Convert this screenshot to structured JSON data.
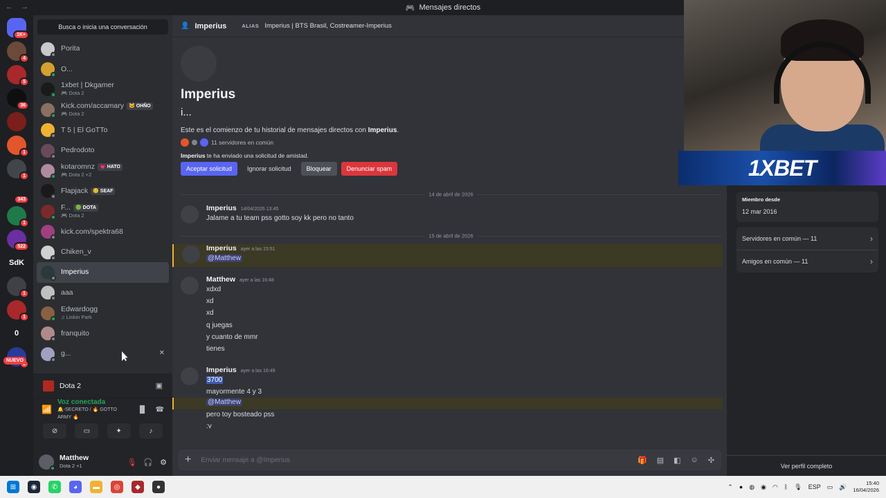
{
  "window": {
    "title": "Mensajes directos",
    "nav_arrows": "← →"
  },
  "guilds": {
    "items": [
      {
        "label": "",
        "badge": "1K+",
        "color": "#5865f2"
      },
      {
        "label": "",
        "badge": "4",
        "color": "#6b4a3a"
      },
      {
        "label": "",
        "badge": "5",
        "color": "#a8282b"
      },
      {
        "label": "",
        "badge": "36",
        "color": "#0f0f10"
      },
      {
        "label": "",
        "badge": "",
        "color": "#7a1f1a"
      },
      {
        "label": "",
        "badge": "1",
        "color": "#e2562d"
      },
      {
        "label": "",
        "badge": "1",
        "color": "#42454a"
      },
      {
        "label": "",
        "badge": "343",
        "color": "#1e1f22"
      },
      {
        "label": "",
        "badge": "1",
        "color": "#1f7a4a"
      },
      {
        "label": "",
        "badge": "522",
        "color": "#6a2fa0"
      },
      {
        "label": "SdK",
        "badge": "",
        "color": "#1e1f22"
      },
      {
        "label": "",
        "badge": "1",
        "color": "#3f4147"
      },
      {
        "label": "",
        "badge": "1",
        "color": "#a8282b"
      },
      {
        "label": "0",
        "badge": "",
        "color": "#1e1f22"
      },
      {
        "label": "",
        "badge": "2",
        "color": "#2a3a9a"
      }
    ],
    "new_label": "NUEVO"
  },
  "dm": {
    "search_label": "Busca o inicia una conversación",
    "items": [
      {
        "name": "Porita",
        "sub": "",
        "tag": "",
        "online": false,
        "color": "#c9c9c9"
      },
      {
        "name": "O...",
        "sub": "",
        "tag": "",
        "online": true,
        "color": "#d4a030"
      },
      {
        "name": "1xbet | Dkgamer",
        "sub": "🎮 Dota 2",
        "tag": "",
        "online": true,
        "color": "#1a1a1a"
      },
      {
        "name": "Kick.com/accamary",
        "sub": "🎮 Dota 2",
        "tag": "🐱 OHÑO",
        "online": true,
        "color": "#8a7060"
      },
      {
        "name": "T 5 | El GoTTo",
        "sub": "",
        "tag": "",
        "online": false,
        "color": "#f0b232"
      },
      {
        "name": "Pedrodoto",
        "sub": "",
        "tag": "",
        "online": false,
        "color": "#6a4a5a"
      },
      {
        "name": "kotaromnz",
        "sub": "🎮 Dota 2 +2",
        "tag": "💗 HATO",
        "online": true,
        "color": "#b08aa0"
      },
      {
        "name": "Flapjack",
        "sub": "",
        "tag": "😊 SEAF",
        "online": false,
        "color": "#1a1a1a"
      },
      {
        "name": "F...",
        "sub": "🎮 Dota 2",
        "tag": "🟢 DOTA",
        "online": true,
        "color": "#7a2a2a"
      },
      {
        "name": "kick.com/spektra68",
        "sub": "",
        "tag": "",
        "online": false,
        "color": "#a04080"
      },
      {
        "name": "Chiken_v",
        "sub": "",
        "tag": "",
        "online": false,
        "color": "#d0d0d0"
      },
      {
        "name": "Imperius",
        "sub": "",
        "tag": "",
        "online": false,
        "color": "#2a3a3a"
      },
      {
        "name": "aaa",
        "sub": "",
        "tag": "",
        "online": false,
        "color": "#c0c0c0"
      },
      {
        "name": "Edwardogg",
        "sub": "♫ Linkin Park",
        "tag": "",
        "online": true,
        "color": "#8a6040"
      },
      {
        "name": "franquito",
        "sub": "",
        "tag": "",
        "online": false,
        "color": "#b08a8a"
      },
      {
        "name": "g...",
        "sub": "",
        "tag": "",
        "online": false,
        "color": "#a0a0c0"
      }
    ],
    "selected_index": 11,
    "hover_index": 15
  },
  "voice": {
    "game": "Dota 2",
    "status": "Voz conectada",
    "channel": "🔔-SECRETO / 🔥 GOTTO ARMY 🔥"
  },
  "user": {
    "name": "Matthew",
    "sub": "Dota 2 +1"
  },
  "header": {
    "name": "Imperius",
    "alias_label": "ALIAS",
    "alias": "Imperius | BTS Brasil, Costreamer-Imperius"
  },
  "intro": {
    "name": "Imperius",
    "handle": "i...",
    "desc_prefix": "Este es el comienzo de tu historial de mensajes directos con ",
    "desc_name": "Imperius",
    "desc_suffix": ".",
    "servers": "11 servidores en común",
    "friend_name": "Imperius",
    "friend_note": " te ha enviado una solicitud de amistad.",
    "actions": [
      "Aceptar solicitud",
      "Ignorar solicitud",
      "Bloquear",
      "Denunciar spam"
    ]
  },
  "dividers": [
    "14 de abril de 2026",
    "15 de abril de 2026"
  ],
  "messages": [
    {
      "author": "Imperius",
      "time": "14/04/2026 13:45",
      "lines": [
        "Jalame a tu team pss gotto soy kk pero no tanto"
      ]
    },
    {
      "author": "Imperius",
      "time": "ayer a las 15:51",
      "lines": [
        "@Matthew"
      ]
    },
    {
      "author": "Matthew",
      "time": "ayer a las 16:48",
      "lines": [
        "xdxd",
        "xd",
        "xd",
        "q juegas",
        "y cuanto de mmr",
        "tienes"
      ]
    },
    {
      "author": "Imperius",
      "time": "ayer a las 16:49",
      "lines": [
        "3700",
        "mayormente 4 y 3",
        "@Matthew",
        "pero toy bosteado pss",
        ":v"
      ]
    }
  ],
  "composer": {
    "placeholder": "Enviar mensaje a @Imperius"
  },
  "profile": {
    "member_label": "Miembro desde",
    "member_value": "12 mar 2016",
    "servers_link": "Servidores en común — 11",
    "friends_link": "Amigos en común — 11",
    "view_full": "Ver perfil completo",
    "banner_text": "1XBET"
  },
  "taskbar": {
    "lang": "ESP",
    "time": "15:40",
    "date": "16/04/2026"
  }
}
